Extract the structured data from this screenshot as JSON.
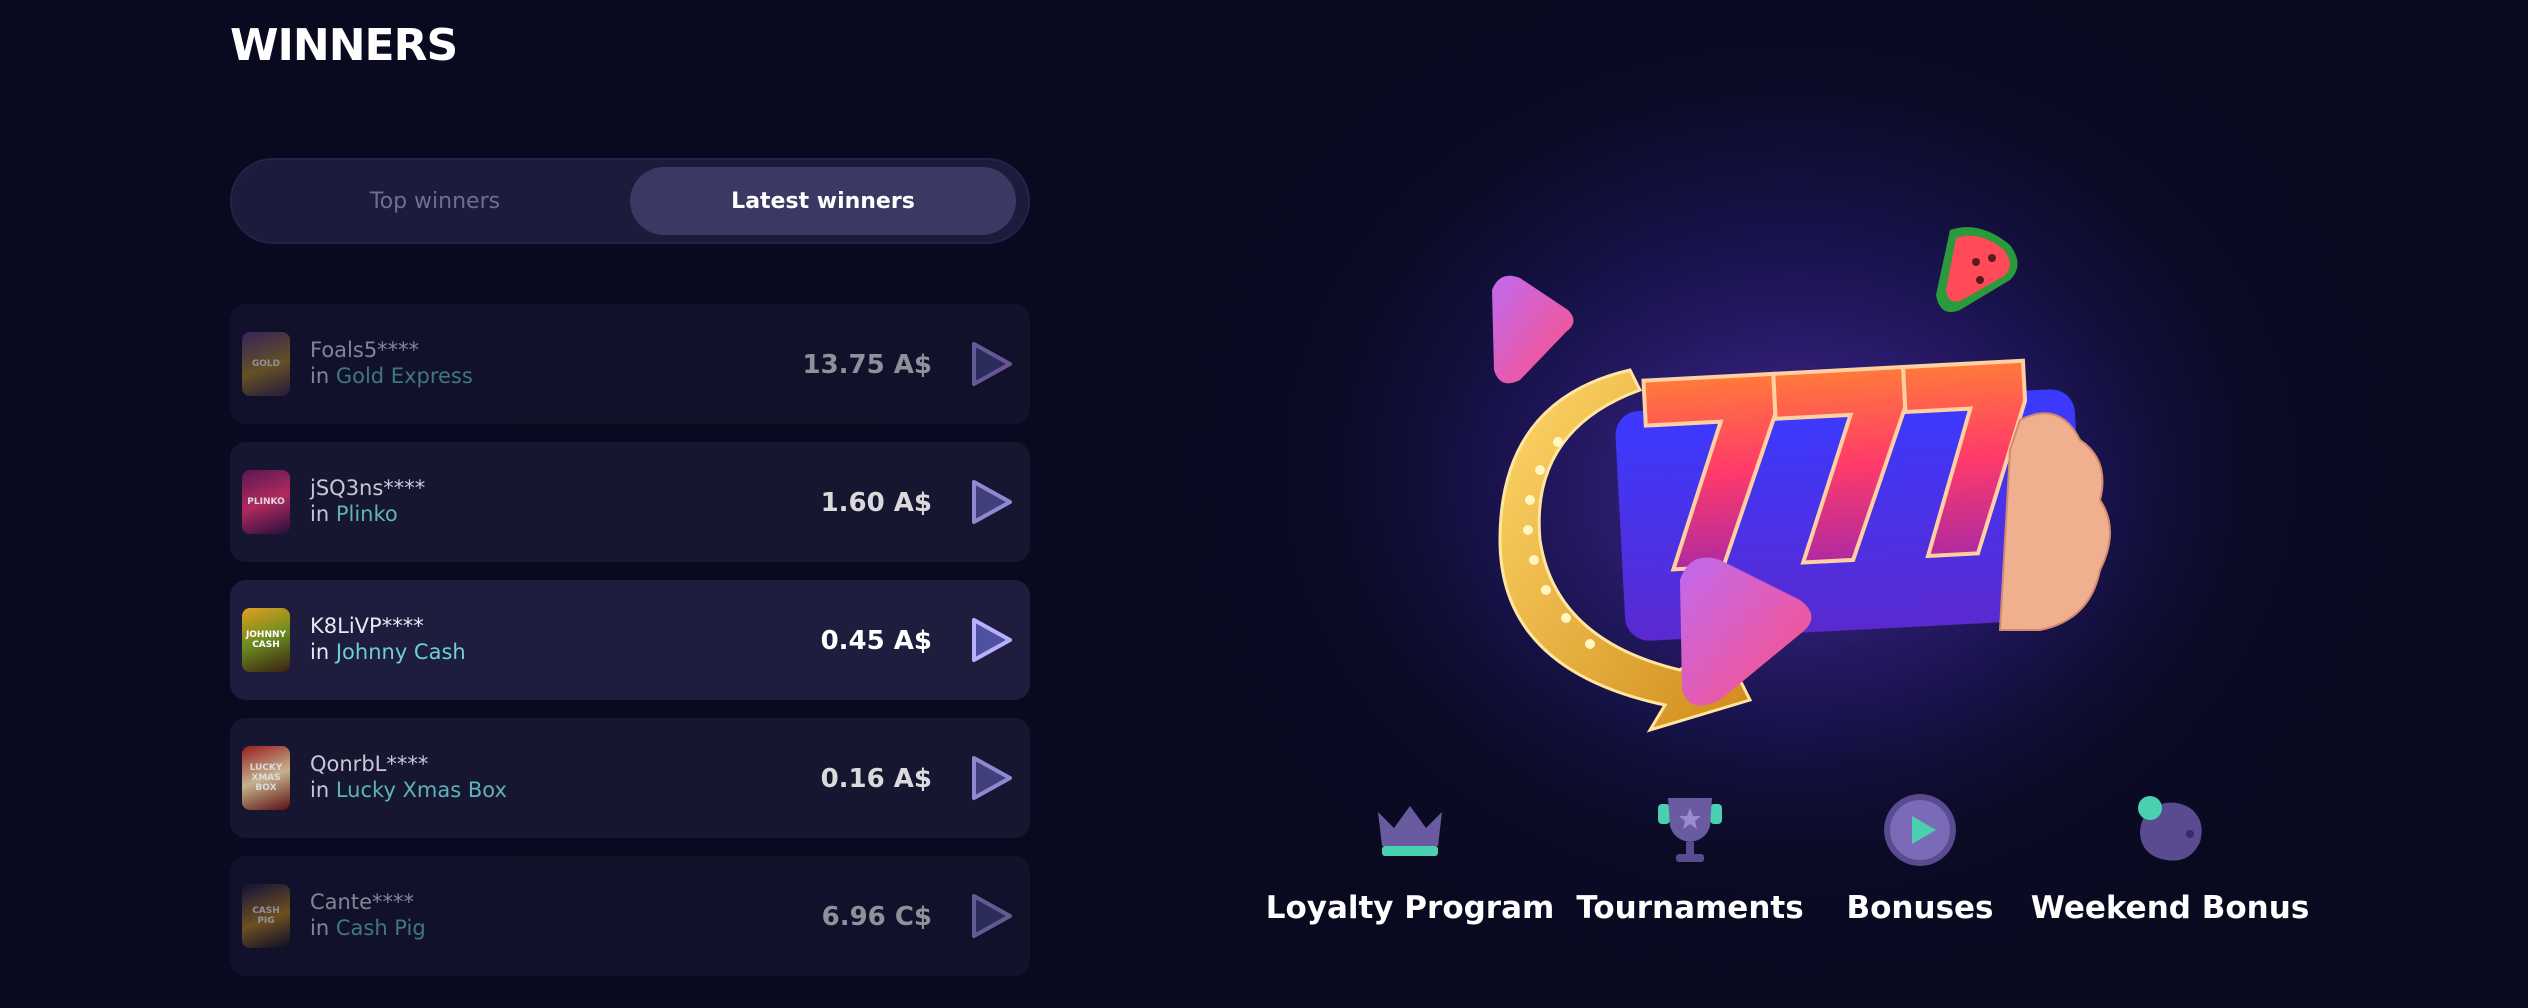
{
  "header": {
    "title": "WINNERS"
  },
  "tabs": [
    {
      "label": "Top winners"
    },
    {
      "label": "Latest winners"
    }
  ],
  "winners": [
    {
      "user": "Foals5****",
      "in": "in",
      "game": "Gold Express",
      "amount": "13.75 A$",
      "thumb": "GOLD"
    },
    {
      "user": "jSQ3ns****",
      "in": "in",
      "game": "Plinko",
      "amount": "1.60 A$",
      "thumb": "PLINKO"
    },
    {
      "user": "K8LiVP****",
      "in": "in",
      "game": "Johnny Cash",
      "amount": "0.45 A$",
      "thumb": "JOHNNY CASH"
    },
    {
      "user": "QonrbL****",
      "in": "in",
      "game": "Lucky Xmas Box",
      "amount": "0.16 A$",
      "thumb": "LUCKY XMAS BOX"
    },
    {
      "user": "Cante****",
      "in": "in",
      "game": "Cash Pig",
      "amount": "6.96 C$",
      "thumb": "CASH PIG"
    }
  ],
  "features": [
    {
      "label": "Loyalty Program",
      "icon": "crown-icon"
    },
    {
      "label": "Tournaments",
      "icon": "trophy-icon"
    },
    {
      "label": "Bonuses",
      "icon": "play-coin-icon"
    },
    {
      "label": "Weekend Bonus",
      "icon": "blob-icon"
    }
  ],
  "colors": {
    "background": "#090920",
    "row": "#191935",
    "game_link": "#6ed0cf",
    "tab_active": "#3b3963"
  }
}
